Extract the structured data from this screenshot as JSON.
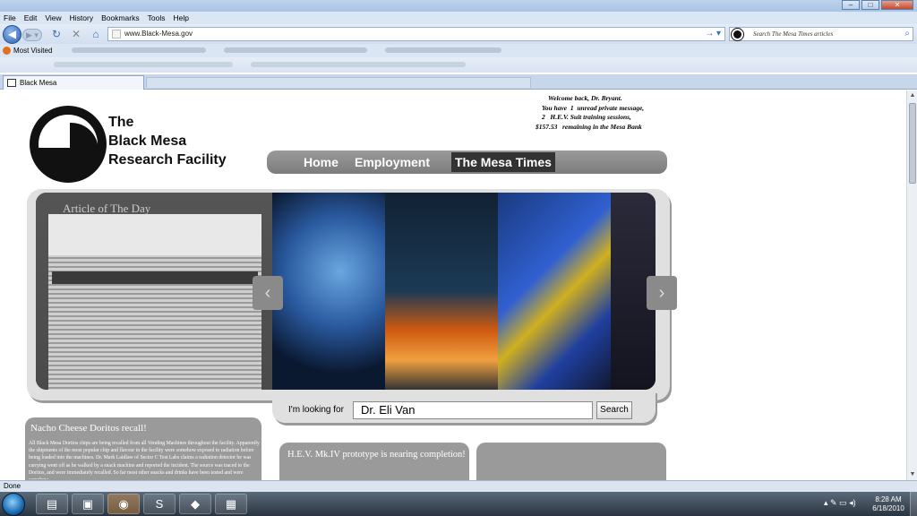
{
  "browser": {
    "menu": [
      "File",
      "Edit",
      "View",
      "History",
      "Bookmarks",
      "Tools",
      "Help"
    ],
    "url": "www.Black-Mesa.gov",
    "search_placeholder": "Search The Mesa Times articles",
    "bookmark": "Most Visited",
    "tab_title": "Black Mesa",
    "status": "Done"
  },
  "site": {
    "logo_text": [
      "The",
      "Black Mesa",
      "Research Facility"
    ],
    "welcome": {
      "title": "Welcome back, Dr. Bryant.",
      "line1": "You have  1  unread private message,",
      "line2": "2   H.E.V. Suit training sessions,",
      "line3": "$157.53   remaining in the Mesa Bank"
    },
    "nav": [
      "Home",
      "Employment",
      "The Mesa Times"
    ],
    "article_of_day": "Article of The Day",
    "search": {
      "label": "I'm looking for",
      "value": "Dr. Eli Van",
      "button": "Search"
    },
    "news": {
      "title": "Nacho Cheese Doritos recall!",
      "body": "All Black Mesa Doritos chips are being recalled from all Vending Machines throughout the facility. Apparently the shipments of the most popular chip and flavour in the facility were somehow exposed to radiation before being loaded into the machines. Dr. Mark Laidlaw of Sector C Test Labs claims a radiation detector he was carrying went off as he walked by a snack machine and reported the incident. The source was traced to the Doritos, and were immediately recalled. So far most other snacks and drinks have been tested and were somehow"
    },
    "hev_title": "H.E.V. Mk.IV prototype is nearing completion!"
  },
  "taskbar": {
    "time": "8:28 AM",
    "date": "6/18/2010"
  },
  "colors": {
    "nav_gray": "#8a8a8a",
    "active_tab": "#333333",
    "panel_gray": "#9a9a9a"
  }
}
